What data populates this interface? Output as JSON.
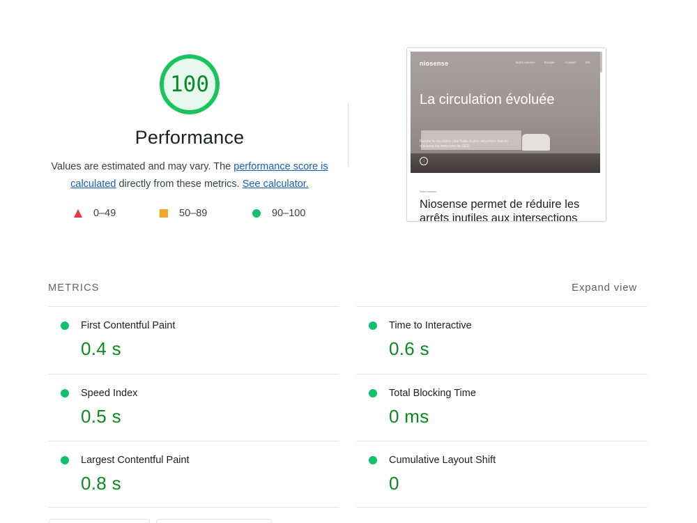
{
  "score": {
    "value": "100",
    "fraction": 1.0,
    "ring_color": "#1ac45c",
    "fill_color": "#e8f8ee",
    "text_color": "#0a8a2a"
  },
  "performance": {
    "title": "Performance",
    "desc_prefix": "Values are estimated and may vary. The ",
    "link_score": "performance score is calculated",
    "desc_middle": " directly from these metrics. ",
    "link_calculator": "See calculator."
  },
  "legend": [
    {
      "label": "0–49",
      "shape": "triangle",
      "color": "#e53935"
    },
    {
      "label": "50–89",
      "shape": "square",
      "color": "#f4a52a"
    },
    {
      "label": "90–100",
      "shape": "circle",
      "color": "#12c26a"
    }
  ],
  "screenshot": {
    "logo": "niosense",
    "nav": [
      "Notre solution",
      "Europe",
      "Contact",
      "EN"
    ],
    "heading": "La circulation évoluée",
    "subtext": "Rendre la circulation plus fluide et plus sécuritaire tout en réduisant les émissions de GES",
    "section_label": "Notre mission",
    "body_text": "Niosense permet de réduire les arrêts inutiles aux intersections"
  },
  "metrics": {
    "title": "METRICS",
    "expand_label": "Expand view",
    "items": [
      {
        "label": "First Contentful Paint",
        "value": "0.4 s",
        "status": "good"
      },
      {
        "label": "Time to Interactive",
        "value": "0.6 s",
        "status": "good"
      },
      {
        "label": "Speed Index",
        "value": "0.5 s",
        "status": "good"
      },
      {
        "label": "Total Blocking Time",
        "value": "0 ms",
        "status": "good"
      },
      {
        "label": "Largest Contentful Paint",
        "value": "0.8 s",
        "status": "good"
      },
      {
        "label": "Cumulative Layout Shift",
        "value": "0",
        "status": "good"
      }
    ]
  }
}
